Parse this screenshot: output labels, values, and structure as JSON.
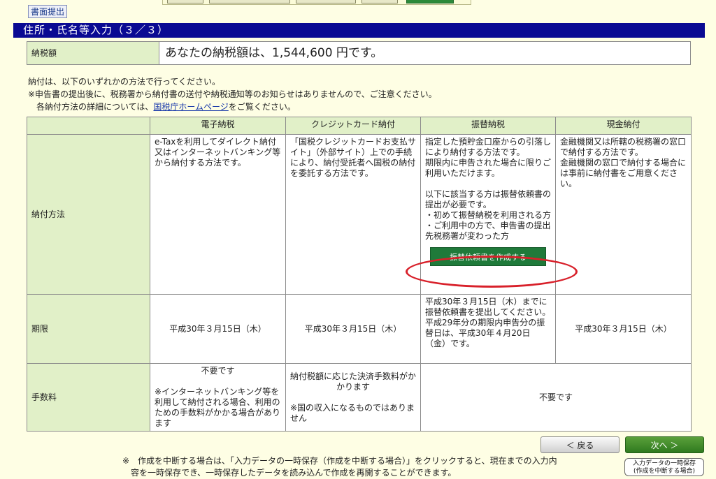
{
  "submit_button": "書面提出",
  "section_title": "住所・氏名等入力（３／３）",
  "tax": {
    "label": "納税額",
    "value": "あなたの納税額は、1,544,600 円です。"
  },
  "notes": {
    "line1": "納付は、以下のいずれかの方法で行ってください。",
    "line2": "※申告書の提出後に、税務署から納付書の送付や納税通知等のお知らせはありませんので、ご注意ください。",
    "line3_prefix": "各納付方法の詳細については、",
    "line3_link": "国税庁ホームページ",
    "line3_suffix": "をご覧ください。"
  },
  "table": {
    "headers": [
      "電子納税",
      "クレジットカード納付",
      "振替納税",
      "現金納付"
    ],
    "rows": {
      "method": {
        "label": "納付方法",
        "electronic": "e-Taxを利用してダイレクト納付又はインターネットバンキング等から納付する方法です。",
        "credit": "「国税クレジットカードお支払サイト」（外部サイト）上での手続により、納付受託者へ国税の納付を委託する方法です。",
        "transfer_1": "指定した預貯金口座からの引落しにより納付する方法です。",
        "transfer_2": "期限内に申告された場合に限りご利用いただけます。",
        "transfer_3": "以下に該当する方は振替依頼書の提出が必要です。",
        "transfer_bullet1": "・初めて振替納税を利用される方",
        "transfer_bullet2": "・ご利用中の方で、申告書の提出先税務署が変わった方",
        "transfer_button": "振替依頼書を作成する",
        "cash_1": "金融機関又は所轄の税務署の窓口で納付する方法です。",
        "cash_2": "金融機関の窓口で納付する場合には事前に納付書をご用意ください。"
      },
      "deadline": {
        "label": "期限",
        "electronic": "平成30年３月15日（木）",
        "credit": "平成30年３月15日（木）",
        "transfer_1": "平成30年３月15日（木）までに振替依頼書を提出してください。",
        "transfer_2": "平成29年分の期限内申告分の振替日は、平成30年４月20日（金）です。",
        "cash": "平成30年３月15日（木）"
      },
      "fee": {
        "label": "手数料",
        "electronic_1": "不要です",
        "electronic_2": "※インターネットバンキング等を利用して納付される場合、利用のための手数料がかかる場合があります",
        "credit_1": "納付税額に応じた決済手数料がかかります",
        "credit_2": "※国の収入になるものではありません",
        "transfer_cash": "不要です"
      }
    }
  },
  "nav": {
    "back": "＜ 戻る",
    "next": "次へ ＞",
    "temp_save_1": "入力データの一時保存",
    "temp_save_2": "(作成を中断する場合)"
  },
  "footnote": {
    "line1": "※　作成を中断する場合は、「入力データの一時保存（作成を中断する場合）」をクリックすると、現在までの入力内",
    "line2": "容を一時保存でき、一時保存したデータを読み込んで作成を再開することができます。"
  },
  "colors": {
    "title_bar": "#0a0a93",
    "header_bg": "#e1f0c8",
    "page_bg": "#fefee4",
    "green_button": "#1f7a3a",
    "highlight_ring": "#d8202a"
  }
}
